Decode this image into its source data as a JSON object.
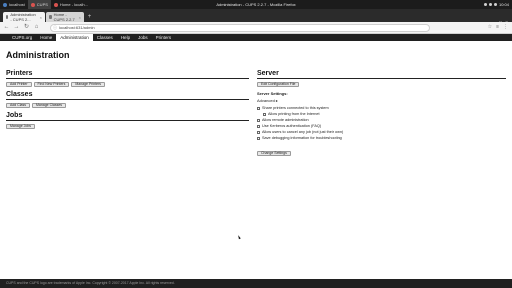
{
  "os_panel": {
    "tabs": [
      {
        "label": "localhost"
      },
      {
        "label": "CUPS"
      },
      {
        "label": "Home - localh..."
      }
    ],
    "window_title": "Administration - CUPS 2.2.7 - Mozilla Firefox",
    "clock": "10:04"
  },
  "browser": {
    "tabs": [
      {
        "label": "Administration - CUPS 2..."
      },
      {
        "label": "Home - CUPS 2.2.7"
      }
    ],
    "new_tab": "+",
    "back": "←",
    "forward": "→",
    "reload": "↻",
    "home": "⌂",
    "url": "localhost:631/admin",
    "toolbar_icons": [
      "≡",
      "☆",
      "⋮"
    ]
  },
  "cups_nav": {
    "brand": "CUPS.org",
    "tabs": [
      "Home",
      "Administration",
      "Classes",
      "Help",
      "Jobs",
      "Printers"
    ],
    "active": "Administration"
  },
  "page": {
    "title": "Administration",
    "printers": {
      "heading": "Printers",
      "buttons": [
        "Add Printer",
        "Find New Printers",
        "Manage Printers"
      ]
    },
    "classes": {
      "heading": "Classes",
      "buttons": [
        "Add Class",
        "Manage Classes"
      ]
    },
    "jobs": {
      "heading": "Jobs",
      "buttons": [
        "Manage Jobs"
      ]
    },
    "server": {
      "heading": "Server",
      "buttons": [
        "Edit Configuration File"
      ],
      "settings_label": "Server Settings:",
      "advanced_label": "Advanced ▸",
      "options": [
        {
          "label": "Share printers connected to this system",
          "indent": false
        },
        {
          "label": "Allow printing from the Internet",
          "indent": true
        },
        {
          "label": "Allow remote administration",
          "indent": false
        },
        {
          "label": "Use Kerberos authentication (FAQ)",
          "indent": false
        },
        {
          "label": "Allow users to cancel any job (not just their own)",
          "indent": false
        },
        {
          "label": "Save debugging information for troubleshooting",
          "indent": false
        }
      ],
      "change_button": "Change Settings"
    }
  },
  "footer": {
    "text": "CUPS and the CUPS logo are trademarks of Apple Inc. Copyright © 2007-2017 Apple Inc. All rights reserved."
  }
}
